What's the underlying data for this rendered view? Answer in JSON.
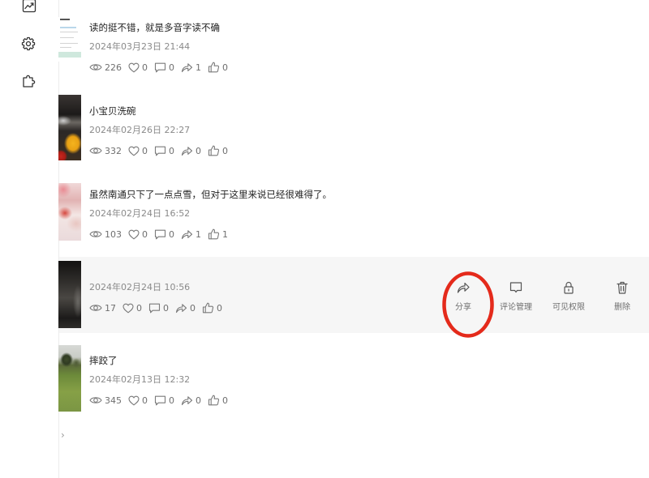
{
  "sidebar": {
    "items": [
      {
        "icon": "trend-chart-icon"
      },
      {
        "icon": "gear-icon"
      },
      {
        "icon": "puzzle-icon"
      }
    ]
  },
  "stat_icons": [
    "eye-icon",
    "heart-icon",
    "comment-icon",
    "share-icon",
    "thumbs-up-icon"
  ],
  "posts": [
    {
      "title": "读的挺不错，就是多音字读不确",
      "date": "2024年03月23日 21:44",
      "stats": [
        "226",
        "0",
        "0",
        "1",
        "0"
      ]
    },
    {
      "title": "小宝贝洗碗",
      "date": "2024年02月26日 22:27",
      "stats": [
        "332",
        "0",
        "0",
        "0",
        "0"
      ]
    },
    {
      "title": "虽然南通只下了一点点雪，但对于这里来说已经很难得了。",
      "date": "2024年02月24日 16:52",
      "stats": [
        "103",
        "0",
        "0",
        "1",
        "1"
      ]
    },
    {
      "date": "2024年02月24日 10:56",
      "stats": [
        "17",
        "0",
        "0",
        "0",
        "0"
      ],
      "active": true
    },
    {
      "title": "摔跤了",
      "date": "2024年02月13日 12:32",
      "stats": [
        "345",
        "0",
        "0",
        "0",
        "0"
      ]
    }
  ],
  "hover_actions": [
    {
      "icon": "share-icon",
      "label": "分享"
    },
    {
      "icon": "comment-icon",
      "label": "评论管理"
    },
    {
      "icon": "lock-icon",
      "label": "可见权限"
    },
    {
      "icon": "trash-icon",
      "label": "删除"
    }
  ],
  "pagination": {
    "next": "›"
  },
  "annotation": {
    "color": "#e42a1b"
  },
  "colors": {
    "hover_background": "#f6f6f6",
    "divider": "#ececec",
    "title_text": "#1f1f1f",
    "muted_text": "#8a8a8a",
    "stat_icon": "#7a7a7a",
    "action_icon": "#555555",
    "sidebar_icon": "#333333"
  }
}
